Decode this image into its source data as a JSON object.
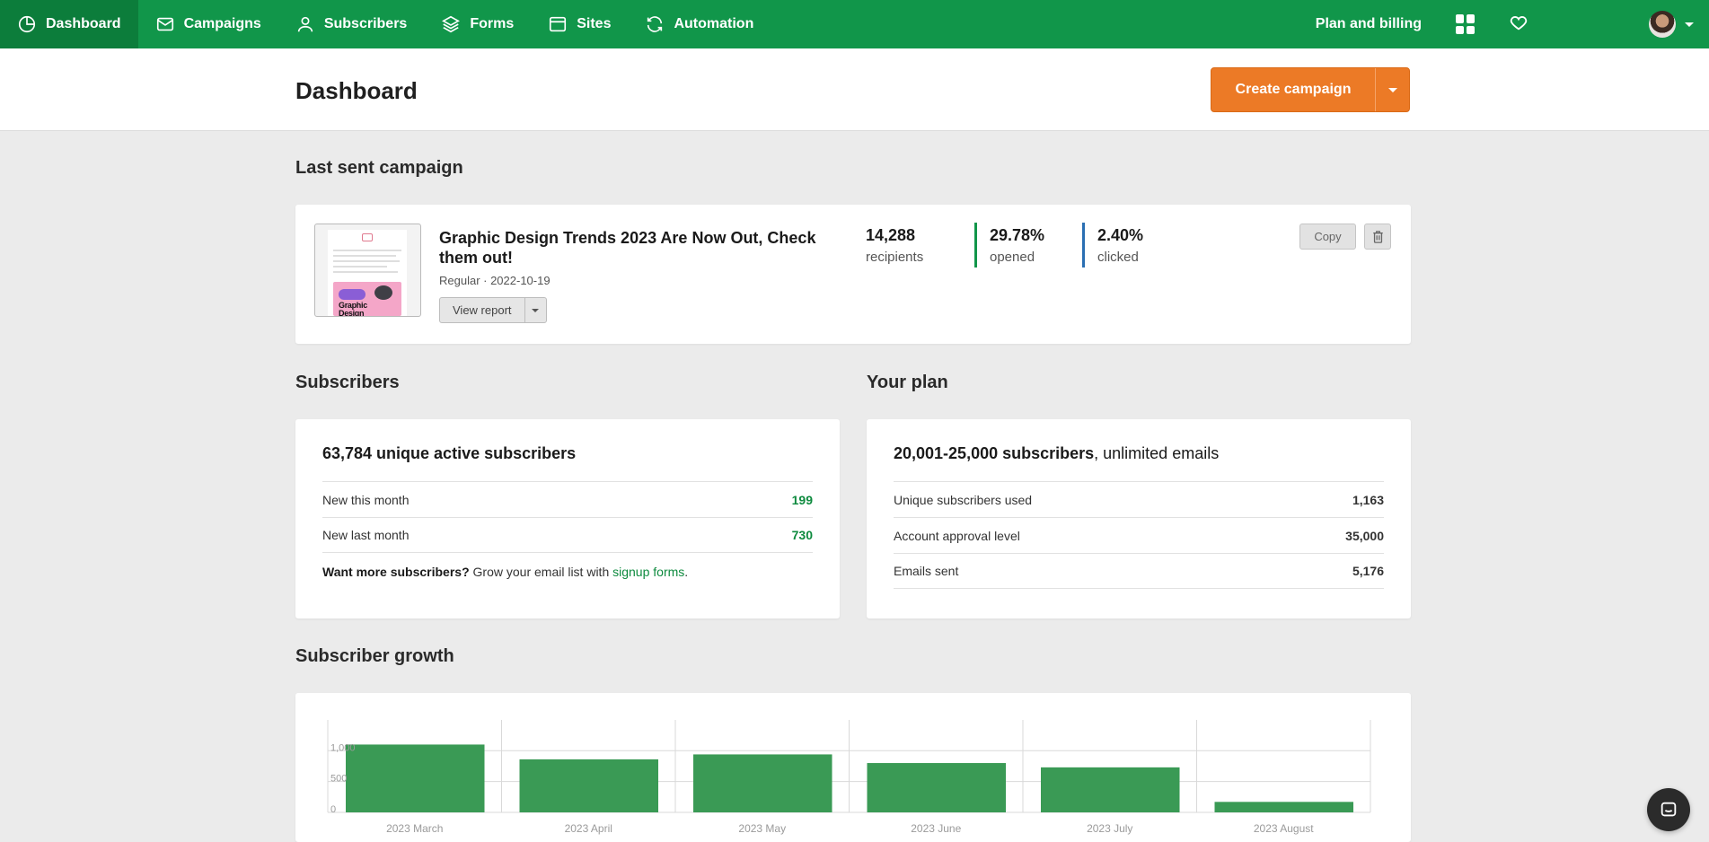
{
  "nav": {
    "items": [
      {
        "label": "Dashboard",
        "icon": "dashboard-icon",
        "active": true
      },
      {
        "label": "Campaigns",
        "icon": "envelope-icon"
      },
      {
        "label": "Subscribers",
        "icon": "user-icon"
      },
      {
        "label": "Forms",
        "icon": "layers-icon"
      },
      {
        "label": "Sites",
        "icon": "browser-icon"
      },
      {
        "label": "Automation",
        "icon": "refresh-icon"
      }
    ],
    "plan_billing": "Plan and billing"
  },
  "header": {
    "title": "Dashboard",
    "create_campaign": "Create campaign"
  },
  "last_campaign": {
    "section_title": "Last sent campaign",
    "title": "Graphic Design Trends 2023 Are Now Out, Check them out!",
    "meta": "Regular · 2022-10-19",
    "view_report": "View report",
    "thumbnail_text": "Graphic Design",
    "stats": [
      {
        "value": "14,288",
        "label": "recipients"
      },
      {
        "value": "29.78%",
        "label": "opened",
        "color": "#11964a"
      },
      {
        "value": "2.40%",
        "label": "clicked",
        "color": "#2a6fb3"
      }
    ],
    "copy": "Copy"
  },
  "subscribers": {
    "section_title": "Subscribers",
    "headline": "63,784 unique active subscribers",
    "rows": [
      {
        "label": "New this month",
        "value": "199"
      },
      {
        "label": "New last month",
        "value": "730"
      }
    ],
    "promo_bold": "Want more subscribers?",
    "promo_text": "Grow your email list with",
    "promo_link": "signup forms",
    "promo_end": "."
  },
  "plan": {
    "section_title": "Your plan",
    "headline_bold": "20,001-25,000 subscribers",
    "headline_rest": ", unlimited emails",
    "rows": [
      {
        "label": "Unique subscribers used",
        "value": "1,163"
      },
      {
        "label": "Account approval level",
        "value": "35,000"
      },
      {
        "label": "Emails sent",
        "value": "5,176"
      }
    ]
  },
  "growth": {
    "section_title": "Subscriber growth"
  },
  "chart_data": {
    "type": "bar",
    "categories": [
      "2023 March",
      "2023 April",
      "2023 May",
      "2023 June",
      "2023 July",
      "2023 August"
    ],
    "values": [
      1100,
      860,
      940,
      800,
      730,
      170
    ],
    "yticks": [
      0,
      500,
      1000
    ],
    "ytick_labels": [
      "0",
      "500",
      "1,000"
    ],
    "ylim": [
      0,
      1400
    ],
    "bar_color": "#3a9a55",
    "grid": true
  },
  "colors": {
    "brand_green": "#11964a",
    "accent_orange": "#ec7a26"
  }
}
